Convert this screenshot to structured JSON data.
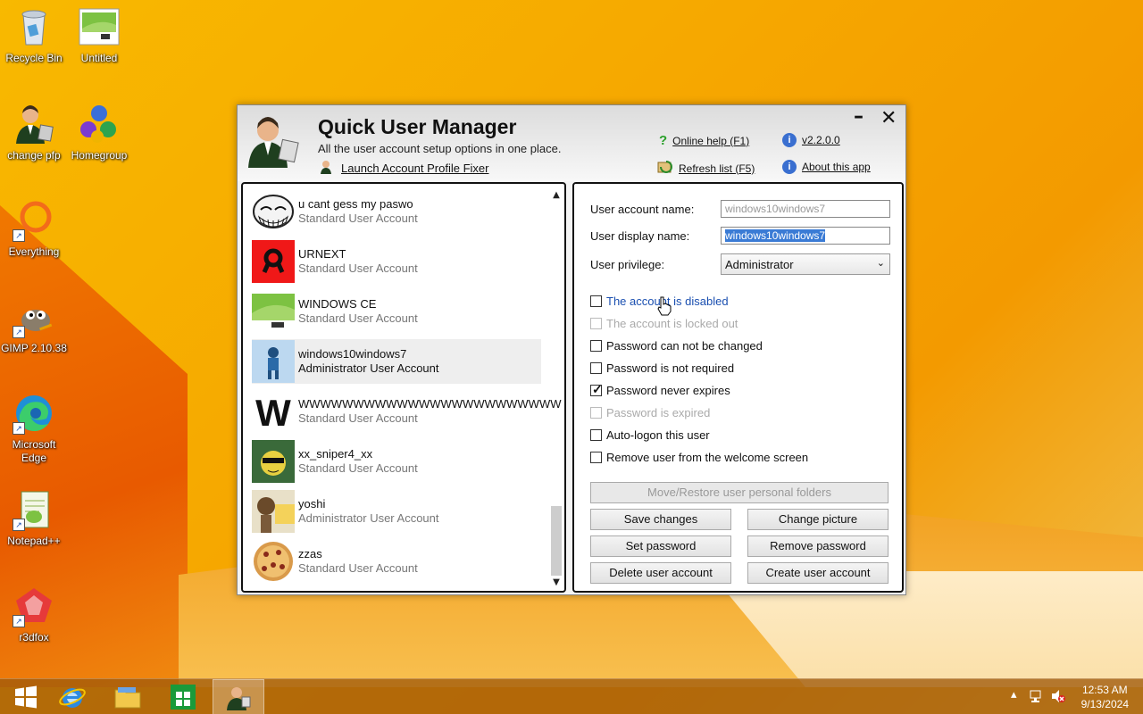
{
  "desktop": {
    "icons": [
      {
        "label": "Recycle Bin",
        "icon": "recycle-bin-icon"
      },
      {
        "label": "Untitled",
        "icon": "image-file-icon"
      },
      {
        "label": "change pfp",
        "icon": "user-manager-icon"
      },
      {
        "label": "Homegroup",
        "icon": "homegroup-icon"
      },
      {
        "label": "Everything",
        "icon": "everything-search-icon"
      },
      {
        "label": "GIMP 2.10.38",
        "icon": "gimp-icon"
      },
      {
        "label": "Microsoft Edge",
        "icon": "edge-icon"
      },
      {
        "label": "Notepad++",
        "icon": "notepadpp-icon"
      },
      {
        "label": "r3dfox",
        "icon": "r3dfox-icon"
      }
    ]
  },
  "window": {
    "title": "Quick User Manager",
    "subtitle": "All the user account setup options in one place.",
    "launch_link": "Launch Account Profile Fixer",
    "online_help": "Online help (F1)",
    "version": "v2.2.0.0",
    "refresh": "Refresh list (F5)",
    "about": "About this app",
    "minimize": "–",
    "close": "✕"
  },
  "users": [
    {
      "name": "u cant gess my paswo",
      "type": "Standard User Account"
    },
    {
      "name": "URNEXT",
      "type": "Standard User Account"
    },
    {
      "name": "WINDOWS CE",
      "type": "Standard User Account"
    },
    {
      "name": "windows10windows7",
      "type": "Administrator User Account"
    },
    {
      "name": "WWWWWWWWWWWWWWWWWWWWWWWW",
      "type": "Standard User Account"
    },
    {
      "name": "xx_sniper4_xx",
      "type": "Standard User Account"
    },
    {
      "name": "yoshi",
      "type": "Administrator User Account"
    },
    {
      "name": "zzas",
      "type": "Standard User Account"
    }
  ],
  "details": {
    "account_name_label": "User account name:",
    "account_name_value": "windows10windows7",
    "display_name_label": "User display name:",
    "display_name_value": "windows10windows7",
    "privilege_label": "User privilege:",
    "privilege_value": "Administrator",
    "checks": [
      {
        "label": "The account is disabled",
        "checked": false
      },
      {
        "label": "The account is locked out",
        "checked": false
      },
      {
        "label": "Password can not be changed",
        "checked": false
      },
      {
        "label": "Password is not required",
        "checked": false
      },
      {
        "label": "Password never expires",
        "checked": true
      },
      {
        "label": "Password is expired",
        "checked": false
      },
      {
        "label": "Auto-logon this user",
        "checked": false
      },
      {
        "label": "Remove user from the welcome screen",
        "checked": false
      }
    ],
    "buttons": {
      "move_restore": "Move/Restore user personal folders",
      "save": "Save changes",
      "change_picture": "Change picture",
      "set_password": "Set password",
      "remove_password": "Remove password",
      "delete": "Delete user account",
      "create": "Create user account"
    }
  },
  "taskbar": {
    "time": "12:53 AM",
    "date": "9/13/2024"
  }
}
